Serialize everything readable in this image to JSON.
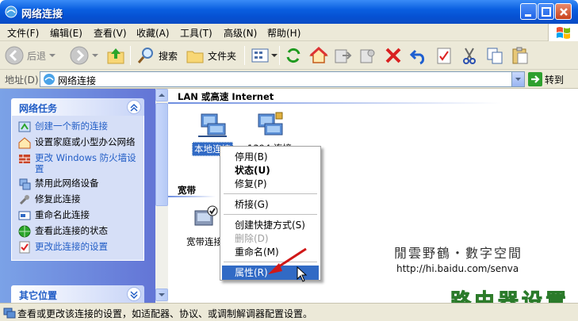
{
  "window": {
    "title": "网络连接"
  },
  "menu": [
    "文件(F)",
    "编辑(E)",
    "查看(V)",
    "收藏(A)",
    "工具(T)",
    "高级(N)",
    "帮助(H)"
  ],
  "toolbar": {
    "back": "后退",
    "search": "搜索",
    "folders": "文件夹"
  },
  "address": {
    "label": "地址(D)",
    "value": "网络连接",
    "go": "转到"
  },
  "sidebar": {
    "tasks_title": "网络任务",
    "tasks": [
      "创建一个新的连接",
      "设置家庭或小型办公网络",
      "更改 Windows 防火墙设置",
      "禁用此网络设备",
      "修复此连接",
      "重命名此连接",
      "查看此连接的状态",
      "更改此连接的设置"
    ],
    "other_title": "其它位置"
  },
  "content": {
    "group1": "LAN 或高速 Internet",
    "conn1": "本地连接",
    "conn2": "1394 连接",
    "group2": "宽带",
    "conn3": "宽带连接"
  },
  "context_menu": [
    "停用(B)",
    "状态(U)",
    "修复(P)",
    "桥接(G)",
    "创建快捷方式(S)",
    "删除(D)",
    "重命名(M)",
    "属性(R)"
  ],
  "status": "查看或更改该连接的设置，如适配器、协议、或调制解调器配置设置。",
  "watermark": {
    "line1": "閒雲野鶴・數字空間",
    "line2": "http://hi.baidu.com/senva",
    "brand": "路由器设置"
  },
  "colors": {
    "title_bar": "#0a5fe0",
    "highlight": "#316ac5",
    "task_link": "#215dc6"
  }
}
